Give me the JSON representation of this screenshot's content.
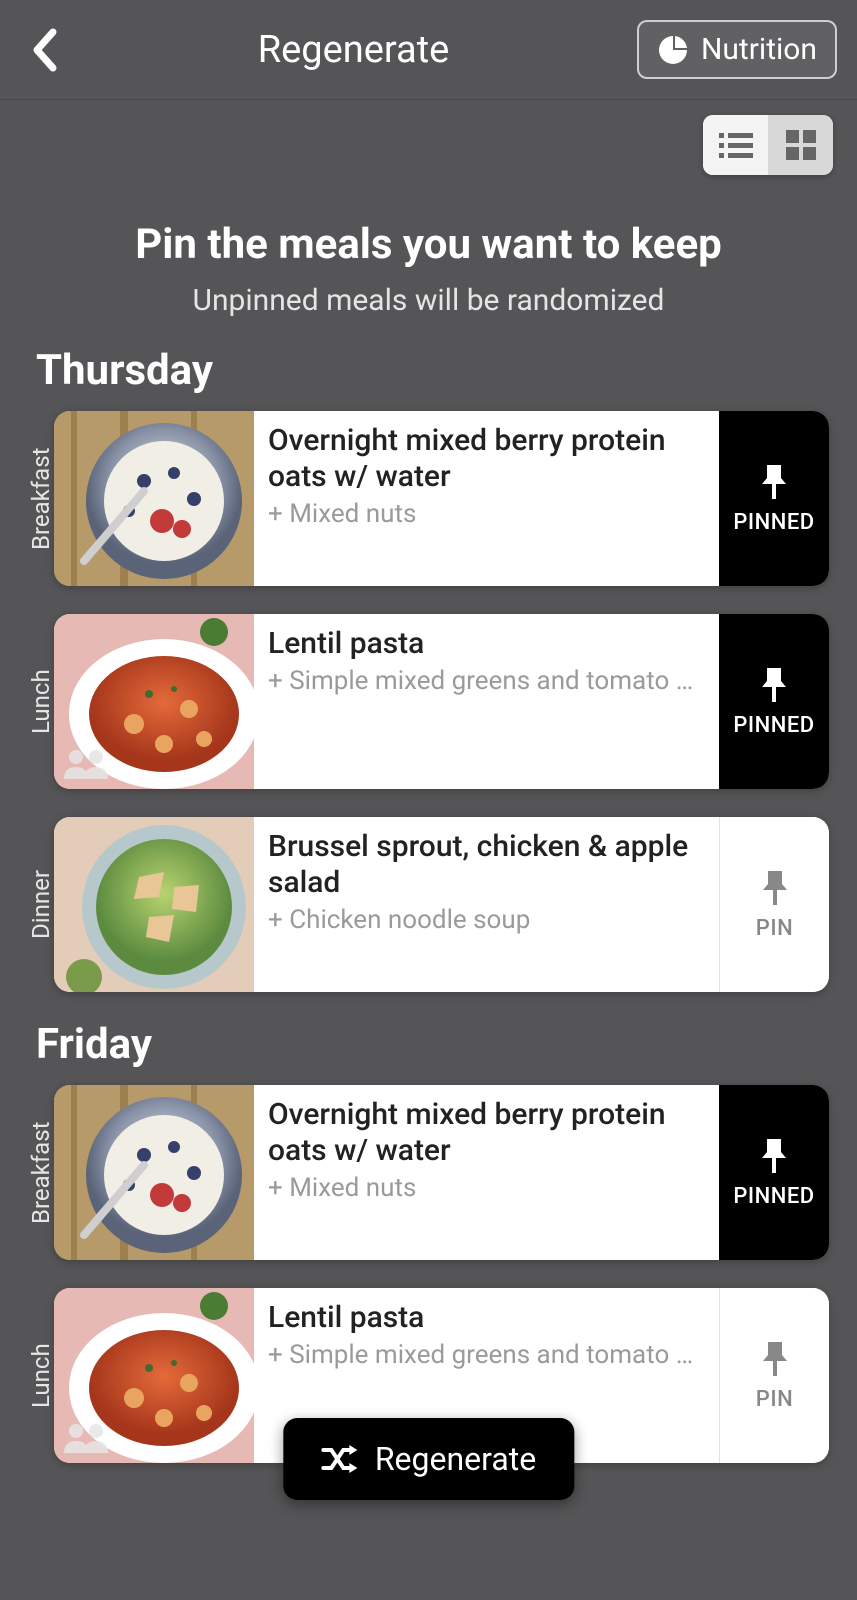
{
  "header": {
    "title": "Regenerate",
    "nutrition_label": "Nutrition"
  },
  "intro": {
    "heading": "Pin the meals you want to keep",
    "subheading": "Unpinned meals will be randomized"
  },
  "days": [
    {
      "name": "Thursday",
      "meals": [
        {
          "slot": "Breakfast",
          "title": "Overnight mixed berry protein oats w/ water",
          "sub": "+ Mixed nuts",
          "pinned": true,
          "pin_label": "PINNED",
          "people": false,
          "image": "oats"
        },
        {
          "slot": "Lunch",
          "title": "Lentil pasta",
          "sub": "+ Simple mixed greens and tomato sa...",
          "pinned": true,
          "pin_label": "PINNED",
          "people": true,
          "image": "pasta"
        },
        {
          "slot": "Dinner",
          "title": "Brussel sprout, chicken & apple salad",
          "sub": "+ Chicken noodle soup",
          "pinned": false,
          "pin_label": "PIN",
          "people": false,
          "image": "salad"
        }
      ]
    },
    {
      "name": "Friday",
      "meals": [
        {
          "slot": "Breakfast",
          "title": "Overnight mixed berry protein oats w/ water",
          "sub": "+ Mixed nuts",
          "pinned": true,
          "pin_label": "PINNED",
          "people": false,
          "image": "oats"
        },
        {
          "slot": "Lunch",
          "title": "Lentil pasta",
          "sub": "+ Simple mixed greens and tomato sa...",
          "pinned": false,
          "pin_label": "PIN",
          "people": true,
          "image": "pasta"
        }
      ]
    }
  ],
  "fab": {
    "label": "Regenerate"
  }
}
